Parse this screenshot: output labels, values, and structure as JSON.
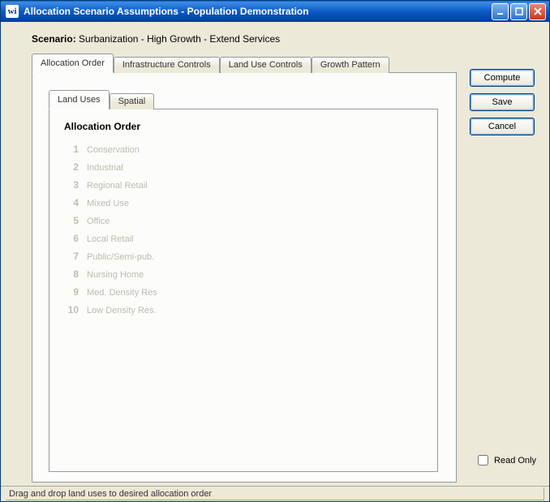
{
  "window": {
    "title": "Allocation Scenario Assumptions - Population Demonstration",
    "app_icon_text": "wi"
  },
  "scenario": {
    "label": "Scenario:",
    "value": "Surbanization - High Growth - Extend Services"
  },
  "outer_tabs": [
    {
      "label": "Allocation Order",
      "active": true
    },
    {
      "label": "Infrastructure Controls",
      "active": false
    },
    {
      "label": "Land Use Controls",
      "active": false
    },
    {
      "label": "Growth Pattern",
      "active": false
    }
  ],
  "inner_tabs": [
    {
      "label": "Land Uses",
      "active": true
    },
    {
      "label": "Spatial",
      "active": false
    }
  ],
  "allocation_order": {
    "header": "Allocation Order",
    "items": [
      {
        "num": "1",
        "name": "Conservation"
      },
      {
        "num": "2",
        "name": "Industrial"
      },
      {
        "num": "3",
        "name": "Regional Retail"
      },
      {
        "num": "4",
        "name": "Mixed Use"
      },
      {
        "num": "5",
        "name": "Office"
      },
      {
        "num": "6",
        "name": "Local Retail"
      },
      {
        "num": "7",
        "name": "Public/Semi-pub."
      },
      {
        "num": "8",
        "name": "Nursing Home"
      },
      {
        "num": "9",
        "name": "Med. Density Res"
      },
      {
        "num": "10",
        "name": "Low Density Res."
      }
    ]
  },
  "buttons": {
    "compute": "Compute",
    "save": "Save",
    "cancel": "Cancel"
  },
  "readonly": {
    "label": "Read Only",
    "checked": false
  },
  "status": "Drag and drop land uses to desired allocation order"
}
